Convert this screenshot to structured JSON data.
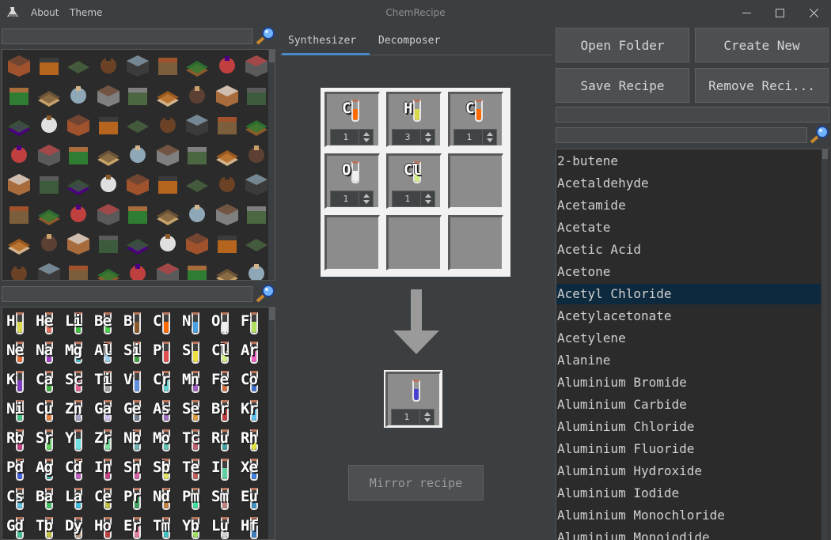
{
  "window": {
    "title": "ChemRecipe",
    "app_icon": "flask-icon",
    "menu": [
      "About",
      "Theme"
    ],
    "controls": [
      "minimize-icon",
      "maximize-icon",
      "close-icon"
    ]
  },
  "left": {
    "block_search": {
      "placeholder": "",
      "icon": "magnifier-icon"
    },
    "element_search": {
      "placeholder": "",
      "icon": "magnifier-icon"
    },
    "elements": [
      {
        "s": "H",
        "c": "#d8d84a"
      },
      {
        "s": "He",
        "c": "#e07060"
      },
      {
        "s": "Li",
        "c": "#40c040"
      },
      {
        "s": "Be",
        "c": "#4bd04b"
      },
      {
        "s": "B",
        "c": "#8b5a2b"
      },
      {
        "s": "C",
        "c": "#ff6a00"
      },
      {
        "s": "N",
        "c": "#4aa0e0"
      },
      {
        "s": "O",
        "c": "#f0f0f0"
      },
      {
        "s": "F",
        "c": "#b0e060"
      },
      {
        "s": "Ne",
        "c": "#e86a30"
      },
      {
        "s": "Na",
        "c": "#a040c0"
      },
      {
        "s": "Mg",
        "c": "#40c0d0"
      },
      {
        "s": "Al",
        "c": "#a0d0f0"
      },
      {
        "s": "Si",
        "c": "#40a040"
      },
      {
        "s": "P",
        "c": "#e05050"
      },
      {
        "s": "S",
        "c": "#f0e040"
      },
      {
        "s": "Cl",
        "c": "#d0f080"
      },
      {
        "s": "Ar",
        "c": "#f060c0"
      },
      {
        "s": "K",
        "c": "#8040c0"
      },
      {
        "s": "Ca",
        "c": "#40b040"
      },
      {
        "s": "Sc",
        "c": "#e06090"
      },
      {
        "s": "Ti",
        "c": "#a0a0a0"
      },
      {
        "s": "V",
        "c": "#6090e0"
      },
      {
        "s": "Cr",
        "c": "#60d0d0"
      },
      {
        "s": "Mn",
        "c": "#a060c0"
      },
      {
        "s": "Fe",
        "c": "#d07040"
      },
      {
        "s": "Co",
        "c": "#4070d0"
      },
      {
        "s": "Ni",
        "c": "#40c080"
      },
      {
        "s": "Cu",
        "c": "#e08040"
      },
      {
        "s": "Zn",
        "c": "#a0a0c0"
      },
      {
        "s": "Ga",
        "c": "#d0c0f0"
      },
      {
        "s": "Ge",
        "c": "#708090"
      },
      {
        "s": "As",
        "c": "#a070c0"
      },
      {
        "s": "Se",
        "c": "#e0a040"
      },
      {
        "s": "Br",
        "c": "#c04040"
      },
      {
        "s": "Kr",
        "c": "#60c0f0"
      },
      {
        "s": "Rb",
        "c": "#c04080"
      },
      {
        "s": "Sr",
        "c": "#60d060"
      },
      {
        "s": "Y",
        "c": "#70e0e0"
      },
      {
        "s": "Zr",
        "c": "#80e0a0"
      },
      {
        "s": "Nb",
        "c": "#70b0b0"
      },
      {
        "s": "Mo",
        "c": "#60c0b0"
      },
      {
        "s": "Tc",
        "c": "#c06070"
      },
      {
        "s": "Ru",
        "c": "#40a0a0"
      },
      {
        "s": "Rh",
        "c": "#e0e040"
      },
      {
        "s": "Pd",
        "c": "#4060e0"
      },
      {
        "s": "Ag",
        "c": "#40b0b0"
      },
      {
        "s": "Cd",
        "c": "#c060c0"
      },
      {
        "s": "In",
        "c": "#c04080"
      },
      {
        "s": "Sn",
        "c": "#d060a0"
      },
      {
        "s": "Sb",
        "c": "#e0e060"
      },
      {
        "s": "Te",
        "c": "#c06060"
      },
      {
        "s": "I",
        "c": "#60d0a0"
      },
      {
        "s": "Xe",
        "c": "#4080e0"
      },
      {
        "s": "Cs",
        "c": "#60c0e0"
      },
      {
        "s": "Ba",
        "c": "#40c060"
      },
      {
        "s": "La",
        "c": "#40c0e0"
      },
      {
        "s": "Ce",
        "c": "#c0c040"
      },
      {
        "s": "Pr",
        "c": "#40a060"
      },
      {
        "s": "Nd",
        "c": "#c08040"
      },
      {
        "s": "Pm",
        "c": "#40e0a0"
      },
      {
        "s": "Sm",
        "c": "#c08080"
      },
      {
        "s": "Eu",
        "c": "#4090c0"
      },
      {
        "s": "Gd",
        "c": "#40c090"
      },
      {
        "s": "Tb",
        "c": "#c0c040"
      },
      {
        "s": "Dy",
        "c": "#c0a080"
      },
      {
        "s": "Ho",
        "c": "#c04040"
      },
      {
        "s": "Er",
        "c": "#e080a0"
      },
      {
        "s": "Tm",
        "c": "#40c0c0"
      },
      {
        "s": "Yb",
        "c": "#a0e060"
      },
      {
        "s": "Lu",
        "c": "#d0d0d0"
      },
      {
        "s": "Hf",
        "c": "#4080c0"
      }
    ]
  },
  "tabs": [
    {
      "label": "Synthesizer",
      "active": true
    },
    {
      "label": "Decomposer",
      "active": false
    }
  ],
  "synthesizer": {
    "slots": [
      {
        "symbol": "C",
        "color": "#ff6a00",
        "count": "1"
      },
      {
        "symbol": "H",
        "color": "#d8d84a",
        "count": "3"
      },
      {
        "symbol": "C",
        "color": "#ff6a00",
        "count": "1"
      },
      {
        "symbol": "O",
        "color": "#f0f0f0",
        "count": "1"
      },
      {
        "symbol": "Cl",
        "color": "#d0f080",
        "count": "1"
      },
      null,
      null,
      null,
      null
    ],
    "output": {
      "color": "#4a40d0",
      "count": "1"
    },
    "mirror_label": "Mirror recipe"
  },
  "actions": {
    "open_folder": "Open Folder",
    "create_new": "Create New",
    "save_recipe": "Save Recipe",
    "remove_recipe": "Remove Reci..."
  },
  "right": {
    "name_field": "",
    "search": {
      "placeholder": "",
      "icon": "magnifier-icon"
    },
    "recipes": [
      "2-butene",
      "Acetaldehyde",
      "Acetamide",
      "Acetate",
      "Acetic Acid",
      "Acetone",
      "Acetyl Chloride",
      "Acetylacetonate",
      "Acetylene",
      "Alanine",
      "Aluminium Bromide",
      "Aluminium Carbide",
      "Aluminium Chloride",
      "Aluminium Fluoride",
      "Aluminium Hydroxide",
      "Aluminium Iodide",
      "Aluminium Monochloride",
      "Aluminium Monoiodide"
    ],
    "selected": "Acetyl Chloride"
  }
}
